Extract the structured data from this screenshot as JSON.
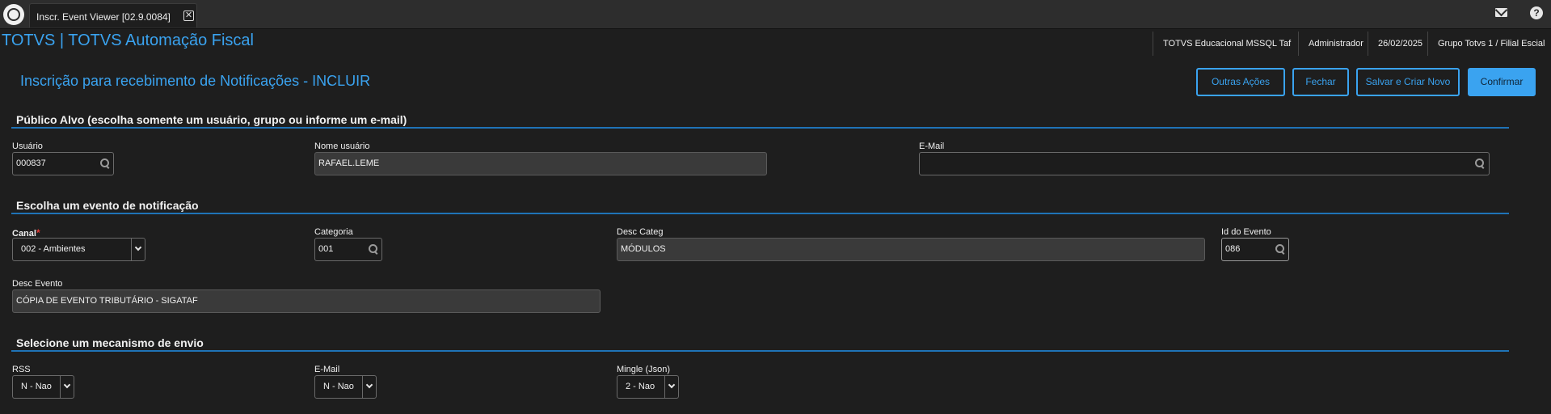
{
  "tabbar": {
    "tab_label": "Inscr. Event Viewer [02.9.0084]",
    "close_glyph": "✕",
    "mail_icon": "mail-icon",
    "help_glyph": "?"
  },
  "header": {
    "app_title": "TOTVS | TOTVS Automação Fiscal",
    "environment": "TOTVS Educacional MSSQL Taf",
    "user": "Administrador",
    "date": "26/02/2025",
    "company": "Grupo Totvs 1 / Filial Escial"
  },
  "page": {
    "title": "Inscrição para recebimento de Notificações - INCLUIR",
    "actions": {
      "other": "Outras Ações",
      "close": "Fechar",
      "save_new": "Salvar e Criar Novo",
      "confirm": "Confirmar"
    }
  },
  "sections": {
    "target": {
      "title": "Público Alvo (escolha somente um usuário, grupo ou informe um e-mail)",
      "user_label": "Usuário",
      "user_value": "000837",
      "user_name_label": "Nome usuário",
      "user_name_value": "RAFAEL.LEME",
      "email_label": "E-Mail",
      "email_value": ""
    },
    "event": {
      "title": "Escolha um evento de notificação",
      "channel_label": "Canal",
      "required_mark": "*",
      "channel_value": "002 - Ambientes",
      "category_label": "Categoria",
      "category_value": "001",
      "category_desc_label": "Desc Categ",
      "category_desc_value": "MÓDULOS",
      "event_id_label": "Id do Evento",
      "event_id_value": "086",
      "event_desc_label": "Desc Evento",
      "event_desc_value": "CÓPIA DE EVENTO TRIBUTÁRIO - SIGATAF"
    },
    "delivery": {
      "title": "Selecione um mecanismo de envio",
      "rss_label": "RSS",
      "rss_value": "N - Nao",
      "email_label": "E-Mail",
      "email_value": "N - Nao",
      "mingle_label": "Mingle (Json)",
      "mingle_value": "2 - Nao"
    }
  },
  "colors": {
    "accent": "#3aa3f0",
    "background": "#1e1e1e",
    "section_line": "#1f73b7",
    "required": "#e53935"
  }
}
